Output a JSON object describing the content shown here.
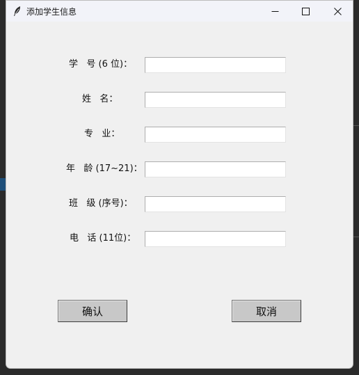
{
  "window": {
    "title": "添加学生信息",
    "icon": "feather-icon",
    "controls": [
      "minimize-icon",
      "maximize-icon",
      "close-icon"
    ]
  },
  "form": {
    "fields": [
      {
        "label": "学   号 (6 位)：",
        "value": ""
      },
      {
        "label": "姓   名：",
        "value": ""
      },
      {
        "label": "专   业：",
        "value": ""
      },
      {
        "label": "年   龄 (17~21)：",
        "value": ""
      },
      {
        "label": "班   级 (序号)：",
        "value": ""
      },
      {
        "label": "电   话 (11位)：",
        "value": ""
      }
    ]
  },
  "buttons": {
    "confirm_label": "确认",
    "cancel_label": "取消"
  },
  "colors": {
    "window_bg": "#f0f0f0",
    "titlebar_bg": "#f2f3f9",
    "button_bg": "#c8c8c8",
    "input_bg": "#ffffff"
  }
}
